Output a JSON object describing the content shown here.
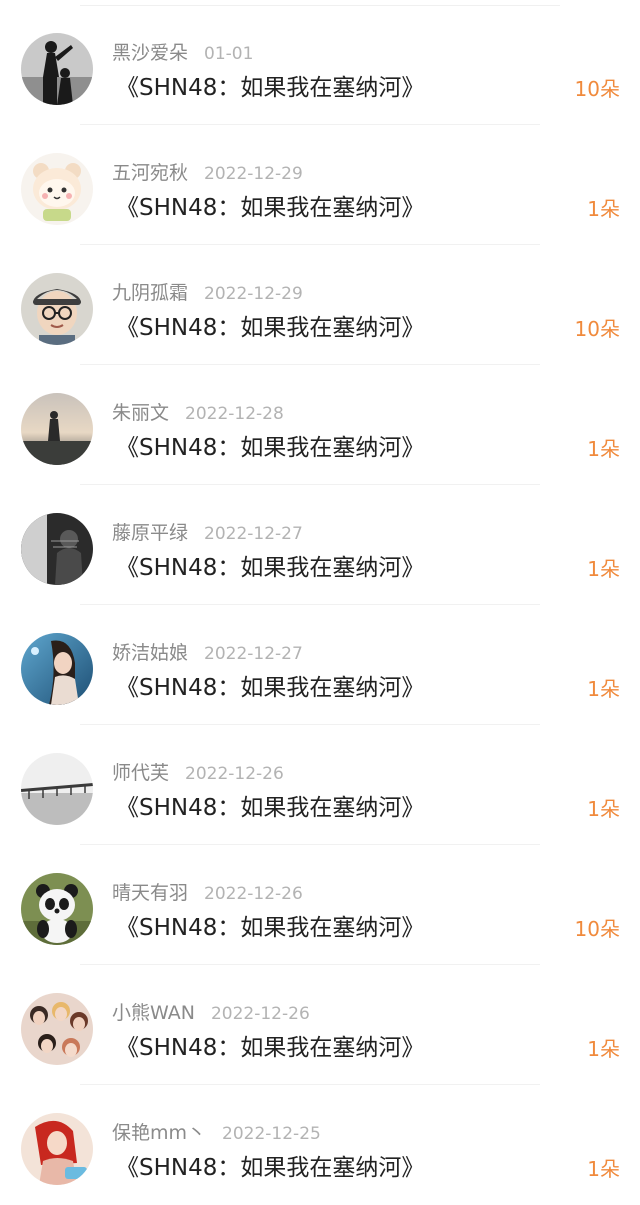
{
  "records": [
    {
      "name": "黑沙爱朵",
      "date": "01-01",
      "work": "《SHN48：如果我在塞纳河》",
      "flowers": "10朵",
      "avatar_icon": "silhouette-avatar-icon"
    },
    {
      "name": "五河宛秋",
      "date": "2022-12-29",
      "work": "《SHN48：如果我在塞纳河》",
      "flowers": "1朵",
      "avatar_icon": "cartoon-bear-avatar-icon"
    },
    {
      "name": "九阴孤霜",
      "date": "2022-12-29",
      "work": "《SHN48：如果我在塞纳河》",
      "flowers": "10朵",
      "avatar_icon": "boy-with-glasses-avatar-icon"
    },
    {
      "name": "朱丽文",
      "date": "2022-12-28",
      "work": "《SHN48：如果我在塞纳河》",
      "flowers": "1朵",
      "avatar_icon": "sunset-figure-avatar-icon"
    },
    {
      "name": "藤原平绿",
      "date": "2022-12-27",
      "work": "《SHN48：如果我在塞纳河》",
      "flowers": "1朵",
      "avatar_icon": "dark-photo-avatar-icon"
    },
    {
      "name": "娇洁姑娘",
      "date": "2022-12-27",
      "work": "《SHN48：如果我在塞纳河》",
      "flowers": "1朵",
      "avatar_icon": "woman-portrait-avatar-icon"
    },
    {
      "name": "师代芙",
      "date": "2022-12-26",
      "work": "《SHN48：如果我在塞纳河》",
      "flowers": "1朵",
      "avatar_icon": "bridge-landscape-avatar-icon"
    },
    {
      "name": "晴天有羽",
      "date": "2022-12-26",
      "work": "《SHN48：如果我在塞纳河》",
      "flowers": "10朵",
      "avatar_icon": "panda-avatar-icon"
    },
    {
      "name": "小熊WAN",
      "date": "2022-12-26",
      "work": "《SHN48：如果我在塞纳河》",
      "flowers": "1朵",
      "avatar_icon": "group-photo-avatar-icon"
    },
    {
      "name": "保艳mm丶",
      "date": "2022-12-25",
      "work": "《SHN48：如果我在塞纳河》",
      "flowers": "1朵",
      "avatar_icon": "woman-red-hair-avatar-icon"
    }
  ],
  "colors": {
    "accent": "#f08a3c",
    "name_text": "#8a8a8a",
    "date_text": "#b3b3b3",
    "title_text": "#222222"
  }
}
